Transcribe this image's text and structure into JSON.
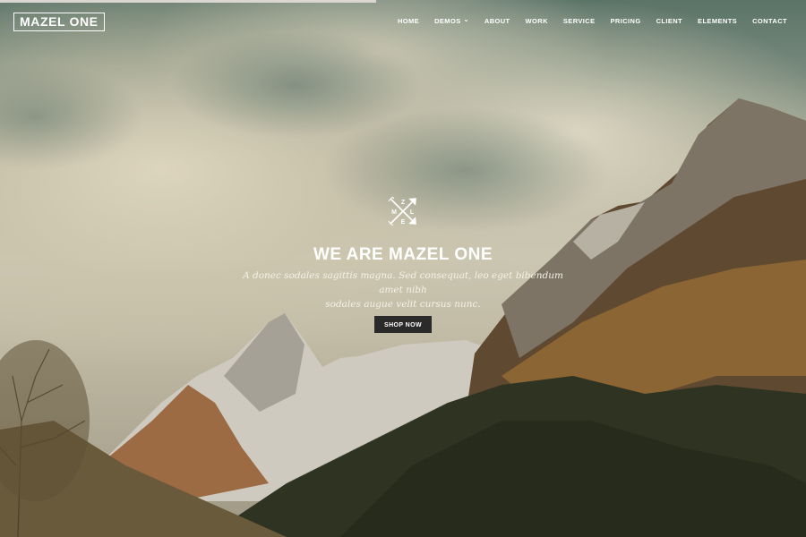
{
  "brand": {
    "logo_text": "MAZEL ONE"
  },
  "nav": {
    "items": [
      {
        "label": "HOME"
      },
      {
        "label": "DEMOS"
      },
      {
        "label": "ABOUT"
      },
      {
        "label": "WORK"
      },
      {
        "label": "SERVICE"
      },
      {
        "label": "PRICING"
      },
      {
        "label": "CLIENT"
      },
      {
        "label": "ELEMENTS"
      },
      {
        "label": "CONTACT"
      }
    ],
    "demos_chevron": "⌄"
  },
  "hero": {
    "emblem_letters": {
      "top": "Z",
      "left": "M",
      "right": "L",
      "bottom": "E"
    },
    "headline": "WE ARE MAZEL ONE",
    "subtext_line1": "A donec sodales sagittis magna. Sed consequat, leo eget bibendum amet nibh",
    "subtext_line2": "sodales augue velit cursus nunc.",
    "cta_label": "SHOP NOW"
  },
  "colors": {
    "button_bg": "#2a2a2a",
    "text": "#ffffff"
  }
}
